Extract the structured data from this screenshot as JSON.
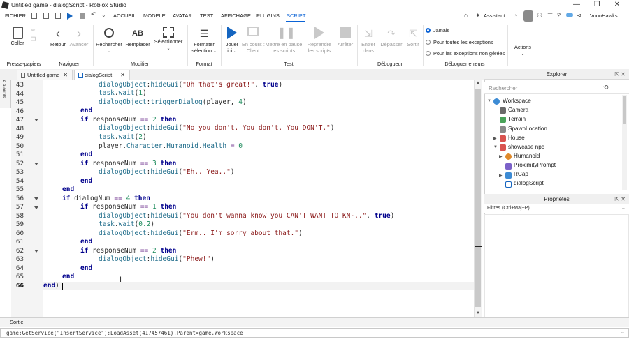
{
  "window": {
    "title": "Untitled game - dialogScript - Roblox Studio",
    "min": "—",
    "max": "❐",
    "close": "✕"
  },
  "menubar": {
    "file": "FICHIER",
    "items": [
      "ACCUEIL",
      "MODELE",
      "AVATAR",
      "TEST",
      "AFFICHAGE",
      "PLUGINS",
      "SCRIPT"
    ],
    "assistant": "Assistant",
    "user": "VoonHawks"
  },
  "ribbon": {
    "paste": "Coller",
    "group_clipboard": "Presse-papiers",
    "back": "Retour",
    "forward": "Avancer",
    "group_nav": "Naviguer",
    "find": "Rechercher",
    "replace": "Remplacer",
    "select": "Sélectionner",
    "group_edit": "Modifier",
    "format": "Formater",
    "format2": "sélection",
    "group_format": "Format",
    "play": "Jouer",
    "play2": "ici",
    "client": "En cours :",
    "client2": "Client",
    "pause": "Mettre en pause",
    "pause2": "les scripts",
    "resume": "Reprendre",
    "resume2": "les scripts",
    "stop": "Arrêter",
    "group_test": "Test",
    "stepin": "Entrer",
    "stepin2": "dans",
    "stepover": "Dépasser",
    "stepout": "Sortir",
    "group_debug": "Débogueur",
    "never": "Jamais",
    "all_exc": "Pour toutes les exceptions",
    "unhandled": "Pour les exceptions non gérées",
    "group_errors": "Déboguer erreurs",
    "actions": "Actions"
  },
  "tabs": [
    {
      "label": "Untitled game"
    },
    {
      "label": "dialogScript"
    }
  ],
  "sidebox": "Boîte à outils",
  "editor": {
    "lines": [
      43,
      44,
      45,
      46,
      47,
      48,
      49,
      50,
      51,
      52,
      53,
      54,
      55,
      56,
      57,
      58,
      59,
      60,
      61,
      62,
      63,
      64,
      65,
      66
    ],
    "current_line": 66
  },
  "output_tab": "Sortie",
  "command": "game:GetService(\"InsertService\"):LoadAsset(417457461).Parent=game.Workspace",
  "explorer": {
    "title": "Explorer",
    "search_placeholder": "Rechercher",
    "items": [
      "Workspace",
      "Camera",
      "Terrain",
      "SpawnLocation",
      "House",
      "showcase npc",
      "Humanoid",
      "ProximityPrompt",
      "RCap",
      "dialogScript"
    ]
  },
  "properties": {
    "title": "Propriétés",
    "filter": "Filtres (Ctrl+Maj+P)"
  }
}
